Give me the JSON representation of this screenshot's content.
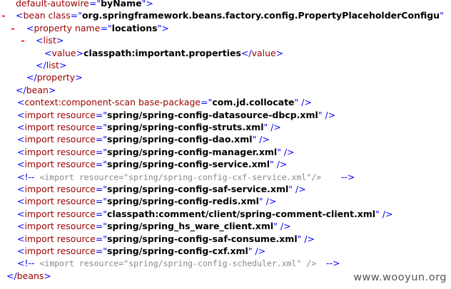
{
  "lines": [
    {
      "indent": 1,
      "toggle": "",
      "kind": "attr-tail",
      "attr": "default-autowire",
      "value": "byName",
      "close": ">"
    },
    {
      "indent": 0,
      "toggle": "-",
      "kind": "open",
      "tag": "bean",
      "attrs": [
        {
          "name": "class",
          "value": "org.springframework.beans.factory.config.PropertyPlaceholderConfigu"
        }
      ],
      "close": ""
    },
    {
      "indent": 1,
      "toggle": "-",
      "kind": "open",
      "tag": "property",
      "attrs": [
        {
          "name": "name",
          "value": "locations"
        }
      ],
      "close": ">"
    },
    {
      "indent": 2,
      "toggle": "-",
      "kind": "open",
      "tag": "list",
      "attrs": [],
      "close": ">"
    },
    {
      "indent": 3,
      "toggle": "",
      "kind": "element",
      "tag": "value",
      "text": "classpath:important.properties"
    },
    {
      "indent": 2,
      "toggle": "",
      "kind": "close",
      "tag": "list"
    },
    {
      "indent": 1,
      "toggle": "",
      "kind": "close",
      "tag": "property"
    },
    {
      "indent": 1,
      "toggle": "",
      "kind": "close",
      "tag": "bean",
      "offset": 0.55
    },
    {
      "indent": 1,
      "toggle": "",
      "kind": "selfclose",
      "tag": "context:component-scan",
      "attrs": [
        {
          "name": "base-package",
          "value": "com.jd.collocate"
        }
      ]
    },
    {
      "indent": 1,
      "toggle": "",
      "kind": "selfclose",
      "tag": "import",
      "attrs": [
        {
          "name": "resource",
          "value": "spring/spring-config-datasource-dbcp.xml"
        }
      ]
    },
    {
      "indent": 1,
      "toggle": "",
      "kind": "selfclose",
      "tag": "import",
      "attrs": [
        {
          "name": "resource",
          "value": "spring/spring-config-struts.xml"
        }
      ]
    },
    {
      "indent": 1,
      "toggle": "",
      "kind": "selfclose",
      "tag": "import",
      "attrs": [
        {
          "name": "resource",
          "value": "spring/spring-config-dao.xml"
        }
      ]
    },
    {
      "indent": 1,
      "toggle": "",
      "kind": "selfclose",
      "tag": "import",
      "attrs": [
        {
          "name": "resource",
          "value": "spring/spring-config-manager.xml"
        }
      ]
    },
    {
      "indent": 1,
      "toggle": "",
      "kind": "selfclose",
      "tag": "import",
      "attrs": [
        {
          "name": "resource",
          "value": "spring/spring-config-service.xml"
        }
      ]
    },
    {
      "indent": 1,
      "toggle": "",
      "kind": "comment",
      "text": "<import resource=\"spring/spring-config-cxf-service.xml\"/>",
      "gap": "    "
    },
    {
      "indent": 1,
      "toggle": "",
      "kind": "selfclose",
      "tag": "import",
      "attrs": [
        {
          "name": "resource",
          "value": "spring/spring-config-saf-service.xml"
        }
      ]
    },
    {
      "indent": 1,
      "toggle": "",
      "kind": "selfclose",
      "tag": "import",
      "attrs": [
        {
          "name": "resource",
          "value": "spring/spring-config-redis.xml"
        }
      ]
    },
    {
      "indent": 1,
      "toggle": "",
      "kind": "selfclose",
      "tag": "import",
      "attrs": [
        {
          "name": "resource",
          "value": "classpath:comment/client/spring-comment-client.xml"
        }
      ]
    },
    {
      "indent": 1,
      "toggle": "",
      "kind": "selfclose",
      "tag": "import",
      "attrs": [
        {
          "name": "resource",
          "value": "spring/spring_hs_ware_client.xml"
        }
      ]
    },
    {
      "indent": 1,
      "toggle": "",
      "kind": "selfclose",
      "tag": "import",
      "attrs": [
        {
          "name": "resource",
          "value": "spring/spring-config-saf-consume.xml"
        }
      ]
    },
    {
      "indent": 1,
      "toggle": "",
      "kind": "selfclose",
      "tag": "import",
      "attrs": [
        {
          "name": "resource",
          "value": "spring/spring-config-cxf.xml"
        }
      ]
    },
    {
      "indent": 1,
      "toggle": "",
      "kind": "comment",
      "text": "<import resource=\"spring/spring-config-scheduler.xml\" />",
      "gap": "  "
    },
    {
      "indent": 0,
      "toggle": "",
      "kind": "close",
      "tag": "beans"
    }
  ],
  "watermark": "www.wooyun.org"
}
